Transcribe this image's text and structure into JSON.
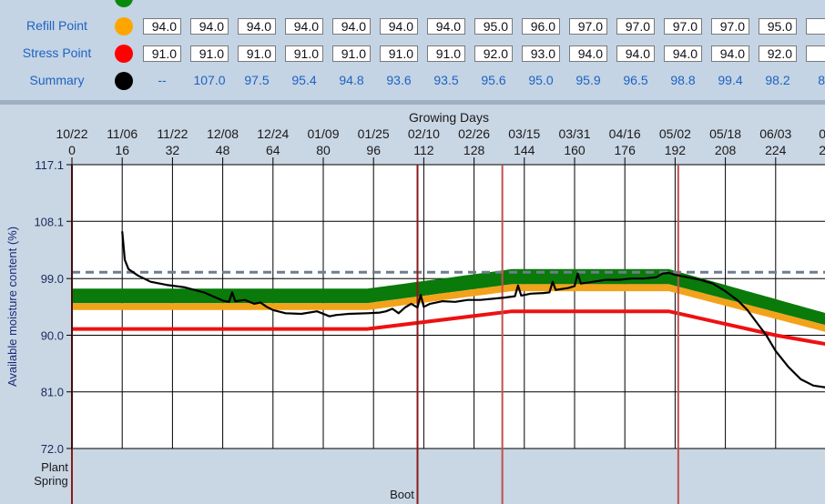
{
  "top_table": {
    "rows": [
      {
        "label": "Refill Point",
        "dot_color": "#ffa500",
        "values": [
          "94.0",
          "94.0",
          "94.0",
          "94.0",
          "94.0",
          "94.0",
          "94.0",
          "95.0",
          "96.0",
          "97.0",
          "97.0",
          "97.0",
          "97.0",
          "95.0",
          "9"
        ]
      },
      {
        "label": "Stress Point",
        "dot_color": "#ff0000",
        "values": [
          "91.0",
          "91.0",
          "91.0",
          "91.0",
          "91.0",
          "91.0",
          "91.0",
          "92.0",
          "93.0",
          "94.0",
          "94.0",
          "94.0",
          "94.0",
          "92.0",
          "9"
        ]
      }
    ],
    "summary": {
      "label": "Summary",
      "dot_color": "#000000",
      "values": [
        "--",
        "107.0",
        "97.5",
        "95.4",
        "94.8",
        "93.6",
        "93.5",
        "95.6",
        "95.0",
        "95.9",
        "96.5",
        "98.8",
        "99.4",
        "98.2",
        "89"
      ]
    }
  },
  "chart_data": {
    "type": "area",
    "title": "",
    "xlabel_top": "Growing Days",
    "ylabel": "Available moisture content (%)",
    "x_range": [
      0,
      240
    ],
    "y_range": [
      72.0,
      117.1
    ],
    "y_ticks": [
      "117.1",
      "108.1",
      "99.0",
      "90.0",
      "81.0",
      "72.0"
    ],
    "y_tick_values": [
      117.1,
      108.1,
      99.0,
      90.0,
      81.0,
      72.0
    ],
    "x_ticks_days": [
      0,
      16,
      32,
      48,
      64,
      80,
      96,
      112,
      128,
      144,
      160,
      176,
      192,
      208,
      224,
      240
    ],
    "x_tick_day_labels": [
      "0",
      "16",
      "32",
      "48",
      "64",
      "80",
      "96",
      "112",
      "128",
      "144",
      "160",
      "176",
      "192",
      "208",
      "224",
      "24"
    ],
    "x_tick_date_labels": [
      "10/22",
      "11/06",
      "11/22",
      "12/08",
      "12/24",
      "01/09",
      "01/25",
      "02/10",
      "02/26",
      "03/15",
      "03/31",
      "04/16",
      "05/02",
      "05/18",
      "06/03",
      "06"
    ],
    "full_point_dashed": 100.0,
    "colors": {
      "full_band": "#0a7a0a",
      "refill_band": "#f2a31b",
      "stress_line": "#ee1111",
      "measured": "#000000",
      "dashed": "#6e7e8e",
      "stage_line": "#8b1a1a",
      "stage_line_light": "#c05050",
      "plot_bg": "#ffffff"
    },
    "series": [
      {
        "name": "Full Point",
        "x": [
          0,
          94,
          140,
          190,
          240
        ],
        "values": [
          97.4,
          97.4,
          100.5,
          100.5,
          93.5
        ]
      },
      {
        "name": "Refill Point",
        "x": [
          0,
          94,
          140,
          190,
          240
        ],
        "values": [
          94.0,
          94.0,
          97.0,
          97.0,
          90.5
        ]
      },
      {
        "name": "Stress Point",
        "x": [
          0,
          94,
          140,
          190,
          224,
          240
        ],
        "values": [
          91.0,
          91.0,
          93.8,
          93.8,
          90.0,
          88.6
        ]
      },
      {
        "name": "Measured",
        "x": [
          16,
          16.3,
          16.8,
          18,
          21,
          25,
          30,
          36,
          42,
          48,
          50,
          51,
          52,
          55,
          58,
          60,
          62,
          64,
          68,
          73,
          78,
          82,
          84,
          88,
          94,
          98,
          100,
          102,
          104,
          106,
          108,
          110,
          111,
          112,
          114,
          118,
          122,
          126,
          130,
          134,
          138,
          141,
          142,
          143,
          146,
          150,
          152,
          153,
          154,
          158,
          160,
          161,
          162,
          166,
          170,
          174,
          178,
          182,
          184,
          186,
          188,
          190,
          192,
          196,
          200,
          204,
          208,
          212,
          215,
          218,
          221,
          224,
          228,
          232,
          236,
          240
        ],
        "values": [
          106.5,
          105.0,
          102.0,
          100.5,
          99.5,
          98.5,
          98.0,
          97.6,
          96.8,
          95.5,
          95.3,
          96.8,
          95.4,
          95.6,
          95.0,
          95.2,
          94.5,
          94.0,
          93.5,
          93.4,
          93.8,
          93.0,
          93.2,
          93.4,
          93.5,
          93.6,
          93.8,
          94.2,
          93.5,
          94.4,
          95.0,
          94.4,
          96.4,
          94.5,
          95.0,
          95.4,
          95.3,
          95.6,
          95.6,
          95.8,
          96.0,
          96.2,
          97.9,
          96.3,
          96.6,
          96.7,
          96.8,
          98.5,
          97.2,
          97.5,
          97.8,
          99.8,
          98.2,
          98.5,
          98.8,
          98.8,
          99.0,
          99.0,
          99.1,
          99.2,
          99.8,
          99.9,
          99.6,
          99.2,
          98.8,
          98.2,
          97.0,
          95.5,
          94.0,
          92.0,
          90.0,
          87.5,
          85.0,
          83.0,
          82.0,
          81.7
        ]
      }
    ],
    "stages": [
      {
        "name": "Plant Spring",
        "label_lines": [
          "Plant",
          "Spring"
        ],
        "day": 0
      },
      {
        "name": "Boot",
        "label_lines": [
          "Boot"
        ],
        "day": 110
      },
      {
        "name": "",
        "label_lines": [],
        "day": 137
      },
      {
        "name": "",
        "label_lines": [],
        "day": 193
      }
    ],
    "grid": true
  }
}
